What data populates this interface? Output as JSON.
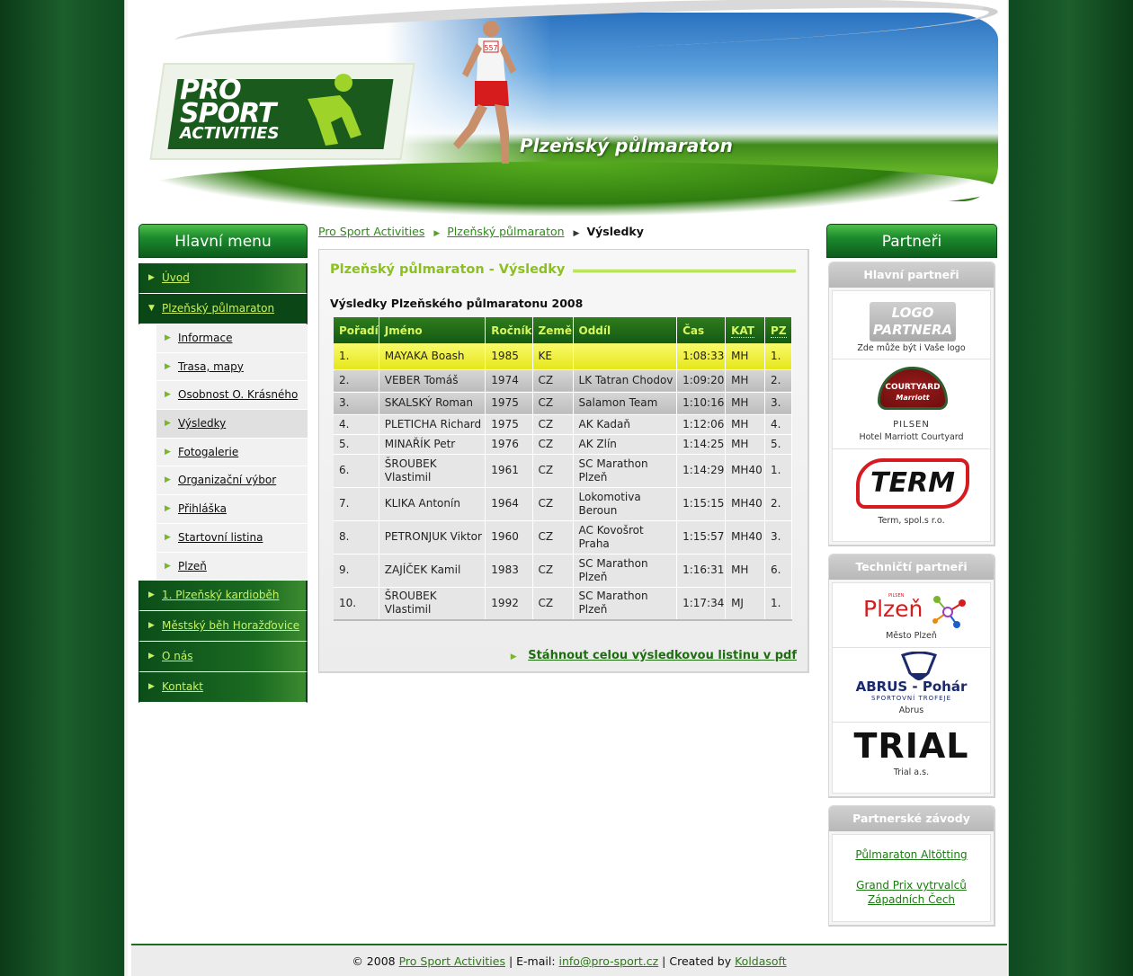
{
  "header": {
    "logo_line1": "PRO",
    "logo_line2": "SPORT",
    "logo_line3": "ACTIVITIES",
    "bib_number": "557",
    "title": "Plzeňský půlmaraton"
  },
  "left_menu": {
    "heading": "Hlavní menu",
    "items_top": [
      {
        "label": "Úvod"
      },
      {
        "label": "Plzeňský půlmaraton"
      }
    ],
    "sub_items": [
      {
        "label": "Informace"
      },
      {
        "label": "Trasa, mapy"
      },
      {
        "label": "Osobnost O. Krásného"
      },
      {
        "label": "Výsledky"
      },
      {
        "label": "Fotogalerie"
      },
      {
        "label": "Organizační výbor"
      },
      {
        "label": "Přihláška"
      },
      {
        "label": "Startovní listina"
      },
      {
        "label": "Plzeň"
      }
    ],
    "items_bottom": [
      {
        "label": "1. Plzeňský kardioběh"
      },
      {
        "label": "Městský běh Horažďovice"
      },
      {
        "label": "O nás"
      },
      {
        "label": "Kontakt"
      }
    ]
  },
  "breadcrumb": {
    "item1": "Pro Sport Activities",
    "item2": "Plzeňský půlmaraton",
    "current": "Výsledky"
  },
  "content": {
    "title": "Plzeňský půlmaraton - Výsledky",
    "subtitle": "Výsledky Plzeňského půlmaratonu 2008",
    "columns": [
      "Pořadí",
      "Jméno",
      "Ročník",
      "Země",
      "Oddíl",
      "Čas",
      "KAT",
      "PZ"
    ],
    "rows": [
      [
        "1.",
        "MAYAKA Boash",
        "1985",
        "KE",
        "",
        "1:08:33",
        "MH",
        "1."
      ],
      [
        "2.",
        "VEBER Tomáš",
        "1974",
        "CZ",
        "LK Tatran Chodov",
        "1:09:20",
        "MH",
        "2."
      ],
      [
        "3.",
        "SKALSKÝ Roman",
        "1975",
        "CZ",
        "Salamon Team",
        "1:10:16",
        "MH",
        "3."
      ],
      [
        "4.",
        "PLETICHA Richard",
        "1975",
        "CZ",
        "AK Kadaň",
        "1:12:06",
        "MH",
        "4."
      ],
      [
        "5.",
        "MINAŘÍK Petr",
        "1976",
        "CZ",
        "AK Zlín",
        "1:14:25",
        "MH",
        "5."
      ],
      [
        "6.",
        "ŠROUBEK Vlastimil",
        "1961",
        "CZ",
        "SC Marathon Plzeň",
        "1:14:29",
        "MH40",
        "1."
      ],
      [
        "7.",
        "KLIKA Antonín",
        "1964",
        "CZ",
        "Lokomotiva Beroun",
        "1:15:15",
        "MH40",
        "2."
      ],
      [
        "8.",
        "PETRONJUK Viktor",
        "1960",
        "CZ",
        "AC Kovošrot Praha",
        "1:15:57",
        "MH40",
        "3."
      ],
      [
        "9.",
        "ZAJÍČEK Kamil",
        "1983",
        "CZ",
        "SC Marathon Plzeň",
        "1:16:31",
        "MH",
        "6."
      ],
      [
        "10.",
        "ŠROUBEK Vlastimil",
        "1992",
        "CZ",
        "SC Marathon Plzeň",
        "1:17:34",
        "MJ",
        "1."
      ]
    ],
    "pdf_link": "Stáhnout celou výsledkovou listinu v pdf"
  },
  "right": {
    "heading": "Partneři",
    "main_partners": {
      "heading": "Hlavní partneři",
      "logo_placeholder": "LOGO PARTNERA",
      "logo_placeholder_l1": "LOGO",
      "logo_placeholder_l2": "PARTNERA",
      "placeholder_caption": "Zde může být i Vaše logo",
      "courtyard_logo": "COURTYARD",
      "courtyard_sub": "Marriott",
      "courtyard_city": "PILSEN",
      "courtyard_caption": "Hotel Marriott Courtyard",
      "term_logo": "TERM",
      "term_caption": "Term, spol.s r.o."
    },
    "tech_partners": {
      "heading": "Techničtí partneři",
      "plzen_logo": "Plzeň",
      "plzen_small": "PILSEN",
      "plzen_caption": "Město Plzeň",
      "abrus_logo": "ABRUS - Pohár",
      "abrus_sub": "SPORTOVNÍ TROFEJE",
      "abrus_caption": "Abrus",
      "trial_logo": "TRIAL",
      "trial_caption": "Trial a.s."
    },
    "partner_races": {
      "heading": "Partnerské závody",
      "link1": "Půlmaraton Altötting",
      "link2": "Grand Prix vytrvalců Západních Čech"
    }
  },
  "footer": {
    "copyright": "© 2008",
    "company": "Pro Sport Activities",
    "email_label": " | E-mail: ",
    "email": "info@pro-sport.cz",
    "created_label": " | Created by ",
    "creator": "Koldasoft"
  },
  "colors": {
    "brand_green": "#1b5a1d",
    "accent_lime": "#c9f25c",
    "title_green": "#8bc020",
    "highlight_yellow": "#e6e71a"
  }
}
